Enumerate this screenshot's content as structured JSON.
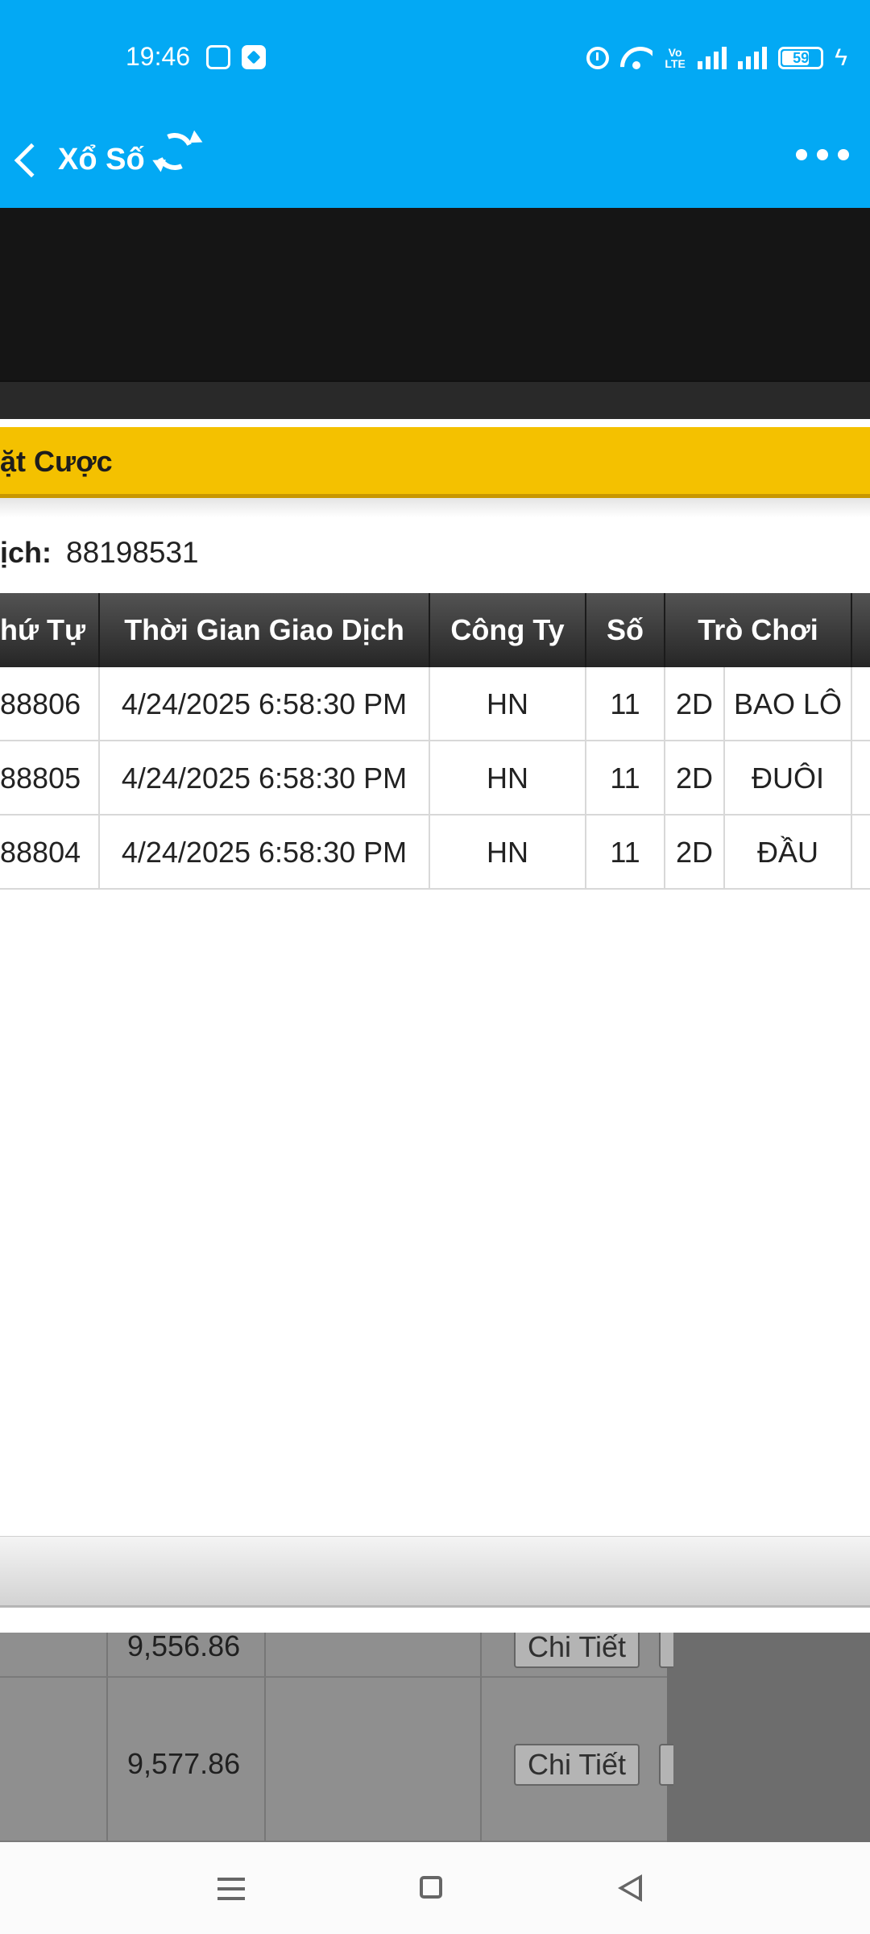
{
  "status_bar": {
    "time": "19:46",
    "network_label": "Vo LTE",
    "battery_level": "59",
    "icons": [
      "app-notification-icon",
      "alarm-icon",
      "wifi-icon",
      "signal-icon",
      "battery-icon",
      "charging-icon"
    ]
  },
  "header": {
    "title": "Xổ Số",
    "icons": [
      "back-icon",
      "refresh-icon",
      "more-icon"
    ],
    "background_color": "#03a9f4"
  },
  "bet_panel": {
    "title": "ặt Cược",
    "transaction_label": "ịch:",
    "transaction_value": "88198531",
    "accent_color": "#f4c100"
  },
  "table": {
    "columns": [
      "hứ Tự",
      "Thời Gian Giao Dịch",
      "Công Ty",
      "Số",
      "Trò Chơi"
    ],
    "rows": [
      {
        "order": "88806",
        "time": "4/24/2025 6:58:30 PM",
        "company": "HN",
        "number": "11",
        "game_type": "2D",
        "game": "BAO LÔ"
      },
      {
        "order": "88805",
        "time": "4/24/2025 6:58:30 PM",
        "company": "HN",
        "number": "11",
        "game_type": "2D",
        "game": "ĐUÔI"
      },
      {
        "order": "88804",
        "time": "4/24/2025 6:58:30 PM",
        "company": "HN",
        "number": "11",
        "game_type": "2D",
        "game": "ĐẦU"
      }
    ]
  },
  "background_table": {
    "rows": [
      {
        "value": "9,556.86",
        "button_label": "Chi Tiết"
      },
      {
        "value": "9,577.86",
        "button_label": "Chi Tiết"
      }
    ]
  },
  "navigation": {
    "icons": [
      "menu-icon",
      "home-icon",
      "back-triangle-icon"
    ]
  }
}
